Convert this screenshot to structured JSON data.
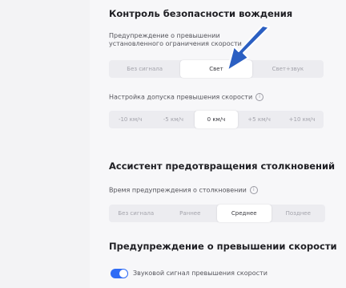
{
  "sections": {
    "driving_safety": {
      "title": "Контроль безопасности вождения"
    },
    "collision_assist": {
      "title": "Ассистент предотвращения столкновений"
    },
    "speed_warning": {
      "title": "Предупреждение о превышении скорости"
    }
  },
  "speed_limit_warning": {
    "label": "Предупреждение о превышении установленного ограничения скорости",
    "options": [
      "Без сигнала",
      "Свет",
      "Свет+звук"
    ],
    "selected": "Свет"
  },
  "speed_tolerance": {
    "label": "Настройка допуска превышения скорости",
    "options": [
      "-10 км/ч",
      "-5 км/ч",
      "0 км/ч",
      "+5 км/ч",
      "+10 км/ч"
    ],
    "selected": "0 км/ч"
  },
  "collision_warning_time": {
    "label": "Время предупреждения о столкновении",
    "options": [
      "Без сигнала",
      "Раннее",
      "Среднее",
      "Позднее"
    ],
    "selected": "Среднее"
  },
  "speed_sound_toggle": {
    "label": "Звуковой сигнал превышения скорости",
    "enabled": true
  },
  "icons": {
    "info": "info-icon",
    "annotation_arrow": "arrow-icon"
  },
  "colors": {
    "accent": "#2f6cf5",
    "arrow": "#2b5fc2"
  }
}
